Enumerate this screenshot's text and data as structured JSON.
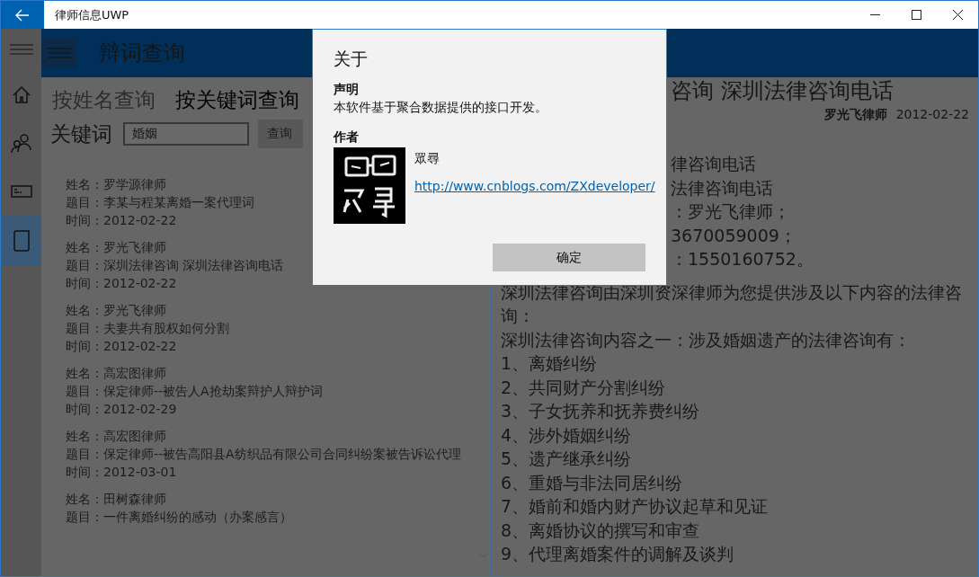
{
  "window": {
    "title": "律师信息UWP"
  },
  "nav_items": [
    {
      "kind": "menu",
      "selected": false
    },
    {
      "kind": "home",
      "selected": false
    },
    {
      "kind": "people",
      "selected": false
    },
    {
      "kind": "card",
      "selected": false
    },
    {
      "kind": "document",
      "selected": true
    }
  ],
  "header": {
    "title": "辩词查询"
  },
  "tabs": [
    {
      "label": "按姓名查询",
      "selected": false
    },
    {
      "label": "按关键词查询",
      "selected": true
    }
  ],
  "search": {
    "label": "关键词",
    "value": "婚姻",
    "button": "查询"
  },
  "results": [
    {
      "lines": [
        {
          "label": "姓名：",
          "value": "罗学源律师"
        },
        {
          "label": "题目：",
          "value": "李某与程某离婚一案代理词"
        },
        {
          "label": "时间：",
          "value": "2012-02-22"
        }
      ]
    },
    {
      "lines": [
        {
          "label": "姓名：",
          "value": "罗光飞律师"
        },
        {
          "label": "题目：",
          "value": "深圳法律咨询 深圳法律咨询电话"
        },
        {
          "label": "时间：",
          "value": "2012-02-22"
        }
      ]
    },
    {
      "lines": [
        {
          "label": "姓名：",
          "value": "罗光飞律师"
        },
        {
          "label": "题目：",
          "value": "夫妻共有股权如何分割"
        },
        {
          "label": "时间：",
          "value": "2012-02-22"
        }
      ]
    },
    {
      "lines": [
        {
          "label": "姓名：",
          "value": "高宏图律师"
        },
        {
          "label": "题目：",
          "value": "保定律师--被告人A抢劫案辩护人辩护词"
        },
        {
          "label": "时间：",
          "value": "2012-02-29"
        }
      ]
    },
    {
      "lines": [
        {
          "label": "姓名：",
          "value": "高宏图律师"
        },
        {
          "label": "题目：",
          "value": "保定律师--被告高阳县A纺织品有限公司合同纠纷案被告诉讼代理"
        },
        {
          "label": "时间：",
          "value": "2012-03-01"
        }
      ]
    },
    {
      "lines": [
        {
          "label": "姓名：",
          "value": "田树森律师"
        },
        {
          "label": "题目：",
          "value": "一件离婚纠纷的感动（办案感言）"
        }
      ]
    }
  ],
  "detail": {
    "title": "咨询 深圳法律咨询电话",
    "author": "罗光飞律师",
    "date": "2012-02-22",
    "covered_lines": [
      "律咨询电话",
      "法律咨询电话",
      "：罗光飞律师；",
      "3670059009；",
      "：1550160752。"
    ],
    "lines": [
      "深圳法律咨询由深圳资深律师为您提供涉及以下内容的法律咨询：",
      "深圳法律咨询内容之一：涉及婚姻遗产的法律咨询有：",
      "1、离婚纠纷",
      "2、共同财产分割纠纷",
      "3、子女抚养和抚养费纠纷",
      "4、涉外婚姻纠纷",
      "5、遗产继承纠纷",
      "6、重婚与非法同居纠纷",
      "7、婚前和婚内财产协议起草和见证",
      "8、离婚协议的撰写和审查",
      "9、代理离婚案件的调解及谈判"
    ]
  },
  "dialog": {
    "title": "关于",
    "statement_heading": "声明",
    "statement": "本软件基于聚合数据提供的接口开发。",
    "author_heading": "作者",
    "author_name": "眾尋",
    "author_link": "http://www.cnblogs.com/ZXdeveloper/",
    "button": "确定"
  }
}
